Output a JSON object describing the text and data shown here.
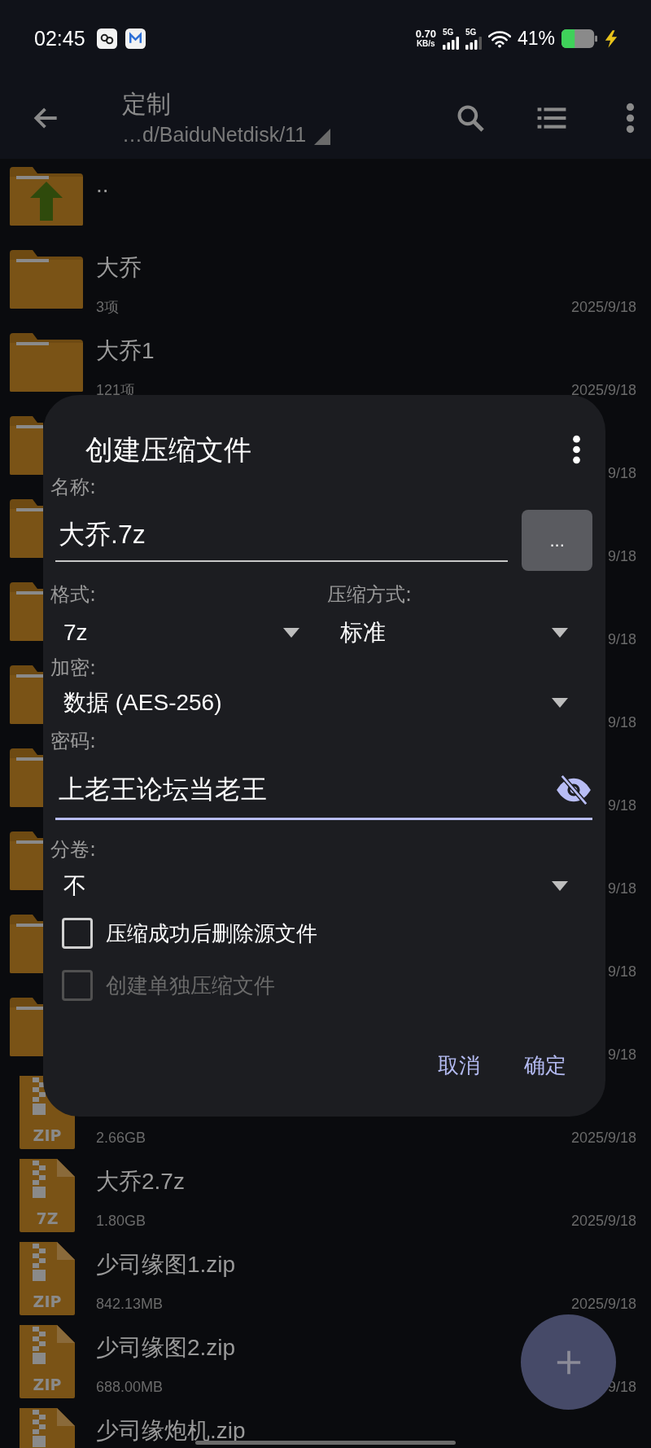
{
  "status_bar": {
    "time": "02:45",
    "net_speed": "0.70",
    "net_unit": "KB/s",
    "signals": [
      "5G",
      "5G"
    ],
    "battery": "41%"
  },
  "toolbar": {
    "title": "定制",
    "path": "…d/BaiduNetdisk/11"
  },
  "files": [
    {
      "kind": "parent",
      "name": ".."
    },
    {
      "kind": "folder",
      "name": "大乔",
      "info": "3项",
      "date": "2025/9/18"
    },
    {
      "kind": "folder",
      "name": "大乔1",
      "info": "121项",
      "date": "2025/9/18"
    },
    {
      "kind": "folder",
      "date": "9/18"
    },
    {
      "kind": "folder",
      "date": "9/18"
    },
    {
      "kind": "folder",
      "date": "9/18"
    },
    {
      "kind": "folder",
      "date": "9/18"
    },
    {
      "kind": "folder",
      "date": "9/18"
    },
    {
      "kind": "folder",
      "date": "9/18"
    },
    {
      "kind": "folder",
      "date": "9/18"
    },
    {
      "kind": "folder",
      "date": "9/18"
    },
    {
      "kind": "archive",
      "badge": "ZIP",
      "info": "2.66GB",
      "date": "2025/9/18"
    },
    {
      "kind": "archive",
      "badge": "7Z",
      "name": "大乔2.7z",
      "info": "1.80GB",
      "date": "2025/9/18"
    },
    {
      "kind": "archive",
      "badge": "ZIP",
      "name": "少司缘图1.zip",
      "info": "842.13MB",
      "date": "2025/9/18"
    },
    {
      "kind": "archive",
      "badge": "ZIP",
      "name": "少司缘图2.zip",
      "info": "688.00MB",
      "date": "9/18"
    },
    {
      "kind": "archive",
      "name": "少司缘炮机.zip"
    }
  ],
  "dialog": {
    "title": "创建压缩文件",
    "name": {
      "label": "名称:",
      "value": "大乔.7z",
      "browse": "..."
    },
    "format": {
      "label": "格式:",
      "value": "7z"
    },
    "method": {
      "label": "压缩方式:",
      "value": "标准"
    },
    "encryption": {
      "label": "加密:",
      "value": "数据 (AES-256)"
    },
    "password": {
      "label": "密码:",
      "value": "上老王论坛当老王"
    },
    "volumes": {
      "label": "分卷:",
      "value": "不"
    },
    "checkboxes": [
      {
        "label": "压缩成功后删除源文件",
        "checked": false,
        "disabled": false
      },
      {
        "label": "创建单独压缩文件",
        "checked": false,
        "disabled": true
      }
    ],
    "buttons": [
      "取消",
      "确定"
    ]
  }
}
